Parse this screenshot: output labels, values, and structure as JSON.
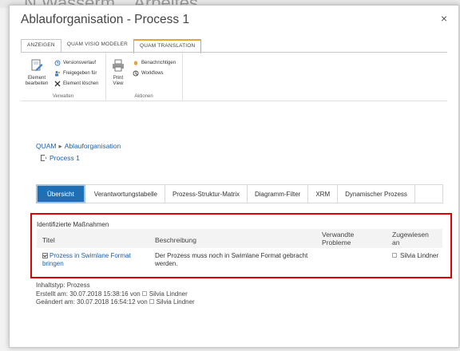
{
  "background": {
    "partial_text": "N Wasserm... Arbeites"
  },
  "dialog": {
    "title": "Ablauforganisation - Process 1",
    "close_glyph": "×"
  },
  "ribbon": {
    "tabs": [
      {
        "label": "ANZEIGEN"
      },
      {
        "label": "QUAM VISIO MODELER"
      },
      {
        "label": "QUAM TRANSLATION"
      }
    ],
    "groups": {
      "verwalten": {
        "label": "Verwalten",
        "edit_line1": "Element",
        "edit_line2": "bearbeiten",
        "versions": "Versionsverlauf",
        "share": "Freigegeben für",
        "delete": "Element löschen"
      },
      "aktionen": {
        "label": "Aktionen",
        "print_line1": "Print",
        "print_line2": "View",
        "notify": "Benachrichtigen",
        "workflows": "Workflows"
      }
    }
  },
  "breadcrumb": {
    "root": "QUAM",
    "separator": "▸",
    "section": "Ablauforganisation",
    "current": "Process 1"
  },
  "tabs": [
    {
      "label": "Übersicht",
      "active": true
    },
    {
      "label": "Verantwortungstabelle"
    },
    {
      "label": "Prozess-Struktur-Matrix"
    },
    {
      "label": "Diagramm-Filter"
    },
    {
      "label": "XRM"
    },
    {
      "label": "Dynamischer Prozess"
    }
  ],
  "measures": {
    "heading": "Identifizierte Maßnahmen",
    "columns": {
      "title": "Titel",
      "description": "Beschreibung",
      "related_line1": "Verwandte",
      "related_line2": "Probleme",
      "assigned_line1": "Zugewiesen",
      "assigned_line2": "an"
    },
    "row": {
      "title_line1": "Prozess in Swimlane Format",
      "title_line2": "bringen",
      "desc_line1": "Der Prozess muss noch in Swimlane Format gebracht",
      "desc_line2": "werden.",
      "related": "",
      "assigned": "Silvia Lindner"
    }
  },
  "meta": {
    "content_type": "Inhaltstyp: Prozess",
    "created_prefix": "Erstellt am: 30.07.2018 15:38:16 von",
    "created_user": "Silvia Lindner",
    "modified_prefix": "Geändert am: 30.07.2018 16:54:12 von",
    "modified_user": "Silvia Lindner"
  },
  "colors": {
    "accent": "#1f6fb5",
    "link": "#1e5fa8",
    "highlight_border": "#e00000",
    "translation_tab": "#e8a33a"
  }
}
